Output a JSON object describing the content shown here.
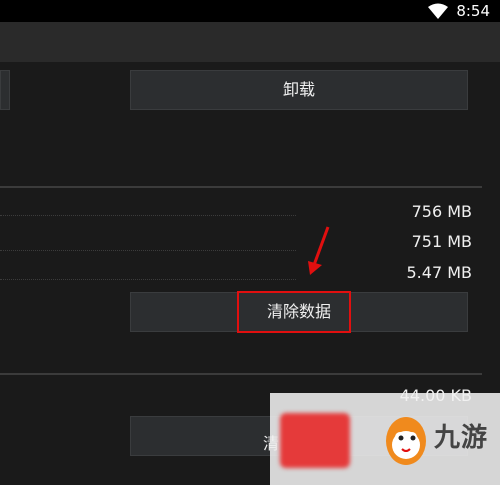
{
  "status_bar": {
    "time": "8:54"
  },
  "buttons": {
    "uninstall": "卸载",
    "clear_data": "清除数据",
    "clear_cache_partial": "清"
  },
  "storage": {
    "rows": [
      {
        "value": "756 MB"
      },
      {
        "value": "751 MB"
      },
      {
        "value": "5.47 MB"
      }
    ]
  },
  "cache": {
    "value": "44.00 KB"
  },
  "watermark": {
    "text": "九游"
  },
  "colors": {
    "highlight": "#e10f0f",
    "background": "#1a1a1a"
  }
}
